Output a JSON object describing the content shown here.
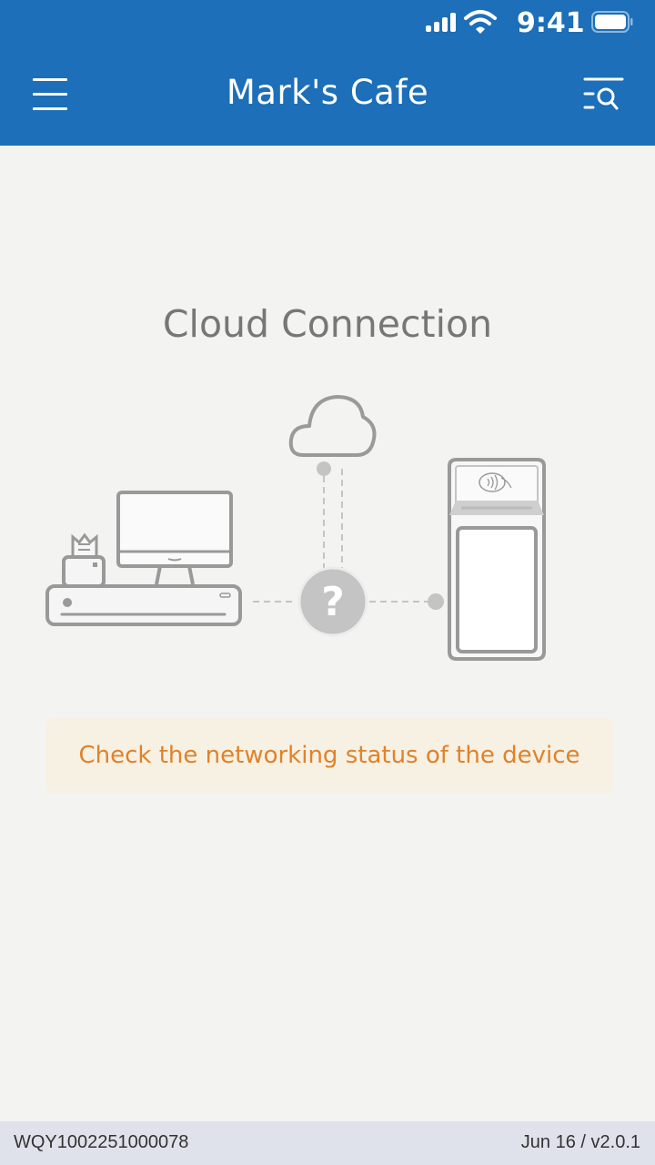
{
  "status_bar": {
    "time": "9:41",
    "icons": [
      "signal-icon",
      "wifi-icon",
      "battery-icon"
    ]
  },
  "header": {
    "title": "Mark's Cafe",
    "left_icon": "hamburger-menu-icon",
    "right_icon": "search-list-icon",
    "background": "#1c6fb8"
  },
  "main": {
    "title": "Cloud Connection",
    "illustration": {
      "nodes": [
        "pos-terminal-icon",
        "cloud-icon",
        "unknown-status-icon",
        "handheld-payment-terminal-icon"
      ],
      "status_symbol": "?"
    },
    "notice": {
      "text": "Check the networking status of the device",
      "color": "#e0822a",
      "background": "#f7f1e3"
    }
  },
  "footer": {
    "serial": "WQY1002251000078",
    "date_version": "Jun 16 / v2.0.1"
  }
}
